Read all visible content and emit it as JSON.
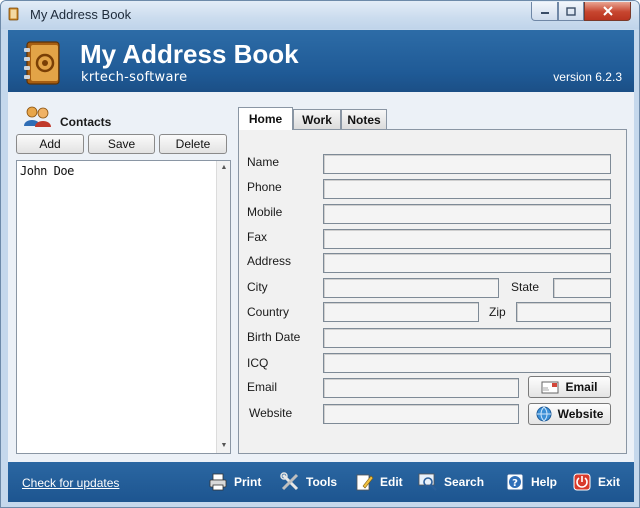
{
  "window": {
    "title": "My Address Book"
  },
  "header": {
    "app_title": "My Address Book",
    "subtitle": "krtech-software",
    "version": "version 6.2.3"
  },
  "contacts": {
    "label": "Contacts",
    "buttons": {
      "add": "Add",
      "save": "Save",
      "delete": "Delete"
    },
    "items": [
      "John  Doe"
    ]
  },
  "tabs": [
    {
      "label": "Home",
      "selected": true
    },
    {
      "label": "Work",
      "selected": false
    },
    {
      "label": "Notes",
      "selected": false
    }
  ],
  "form": {
    "name": {
      "label": "Name",
      "value": ""
    },
    "phone": {
      "label": "Phone",
      "value": ""
    },
    "mobile": {
      "label": "Mobile",
      "value": ""
    },
    "fax": {
      "label": "Fax",
      "value": ""
    },
    "address": {
      "label": "Address",
      "value": ""
    },
    "city": {
      "label": "City",
      "value": ""
    },
    "state": {
      "label": "State",
      "value": ""
    },
    "country": {
      "label": "Country",
      "value": ""
    },
    "zip": {
      "label": "Zip",
      "value": ""
    },
    "birth_date": {
      "label": "Birth Date",
      "value": ""
    },
    "icq": {
      "label": "ICQ",
      "value": ""
    },
    "email": {
      "label": "Email",
      "value": ""
    },
    "website": {
      "label": "Website",
      "value": ""
    },
    "email_button": "Email",
    "website_button": "Website"
  },
  "footer": {
    "updates_link": "Check for updates",
    "buttons": {
      "print": "Print",
      "tools": "Tools",
      "edit": "Edit",
      "search": "Search",
      "help": "Help",
      "exit": "Exit"
    }
  },
  "colors": {
    "banner": "#1f5a96",
    "chrome": "#c5d8ec",
    "panel": "#ecf1f7"
  },
  "icons": {
    "title": "book-icon",
    "banner": "address-book-icon",
    "contacts": "people-icon",
    "email": "envelope-icon",
    "website": "globe-icon",
    "print": "printer-icon",
    "tools": "tools-icon",
    "edit": "edit-icon",
    "search": "search-icon",
    "help": "help-icon",
    "exit": "power-icon"
  }
}
